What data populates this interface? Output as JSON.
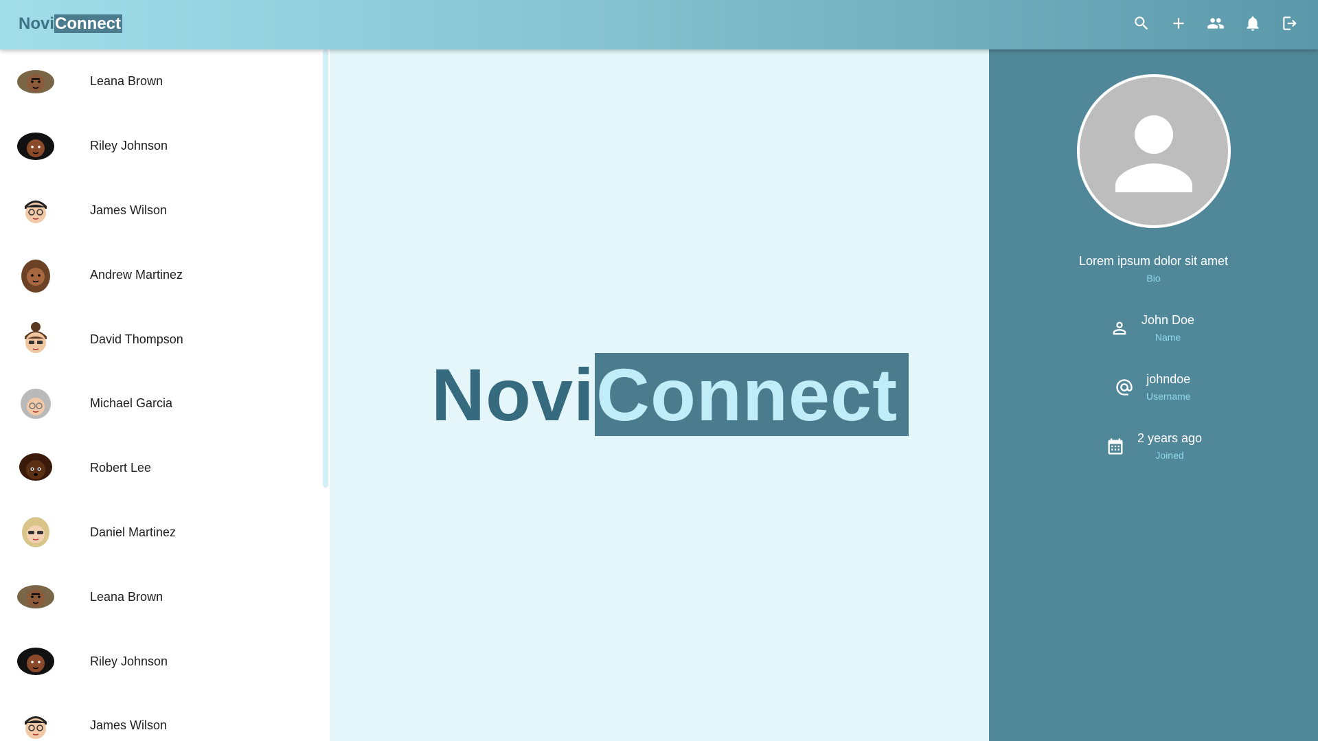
{
  "header": {
    "logo_part1": "Novi",
    "logo_part2": "Connect",
    "actions": [
      {
        "icon": "search-icon"
      },
      {
        "icon": "plus-icon"
      },
      {
        "icon": "people-icon"
      },
      {
        "icon": "bell-icon"
      },
      {
        "icon": "logout-icon"
      }
    ]
  },
  "contacts": [
    {
      "name": "Leana Brown",
      "avatar": "curly-brown-hair-avatar"
    },
    {
      "name": "Riley Johnson",
      "avatar": "black-hair-avatar"
    },
    {
      "name": "James Wilson",
      "avatar": "glasses-avatar"
    },
    {
      "name": "Andrew Martinez",
      "avatar": "brown-long-hair-avatar"
    },
    {
      "name": "David Thompson",
      "avatar": "bun-hair-glasses-avatar"
    },
    {
      "name": "Michael Garcia",
      "avatar": "gray-hair-avatar"
    },
    {
      "name": "Robert Lee",
      "avatar": "dark-curly-hair-avatar"
    },
    {
      "name": "Daniel Martinez",
      "avatar": "blonde-sunglasses-avatar"
    },
    {
      "name": "Leana Brown",
      "avatar": "curly-brown-hair-avatar"
    },
    {
      "name": "Riley Johnson",
      "avatar": "black-hair-avatar"
    },
    {
      "name": "James Wilson",
      "avatar": "glasses-avatar"
    }
  ],
  "hero": {
    "part1": "Novi",
    "part2": "Connect"
  },
  "profile": {
    "bio": "Lorem ipsum dolor sit amet",
    "bio_label": "Bio",
    "name": "John Doe",
    "name_label": "Name",
    "username": "johndoe",
    "username_label": "Username",
    "joined": "2 years ago",
    "joined_label": "Joined"
  },
  "colors": {
    "header_start": "#a1deea",
    "header_end": "#5b98aa",
    "accent": "#4a7c8e",
    "panel": "#518899",
    "background": "#e4f6fa",
    "label": "#8fd8ea"
  }
}
